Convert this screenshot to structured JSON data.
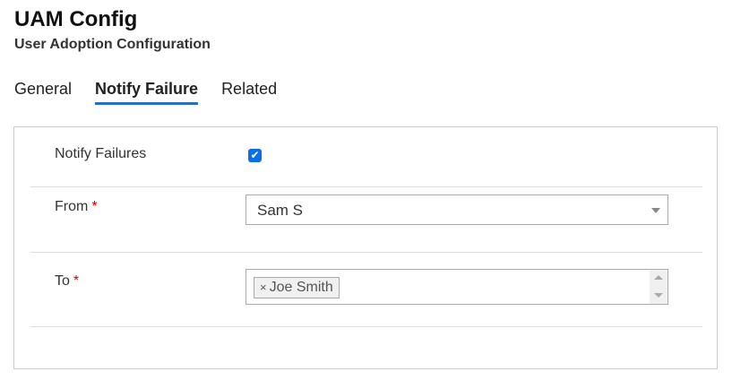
{
  "header": {
    "title": "UAM Config",
    "subtitle": "User Adoption Configuration"
  },
  "tabs": [
    {
      "label": "General"
    },
    {
      "label": "Notify Failure",
      "active": true
    },
    {
      "label": "Related"
    }
  ],
  "form": {
    "notify_failures": {
      "label": "Notify Failures",
      "checked": true
    },
    "from": {
      "label": "From",
      "required": "*",
      "value": "Sam S"
    },
    "to": {
      "label": "To",
      "required": "*",
      "chips": [
        "Joe Smith"
      ],
      "chip_remove": "×"
    }
  },
  "colors": {
    "accent": "#2b6cc4",
    "checkbox": "#0b6ee6",
    "required": "#cc0000"
  }
}
